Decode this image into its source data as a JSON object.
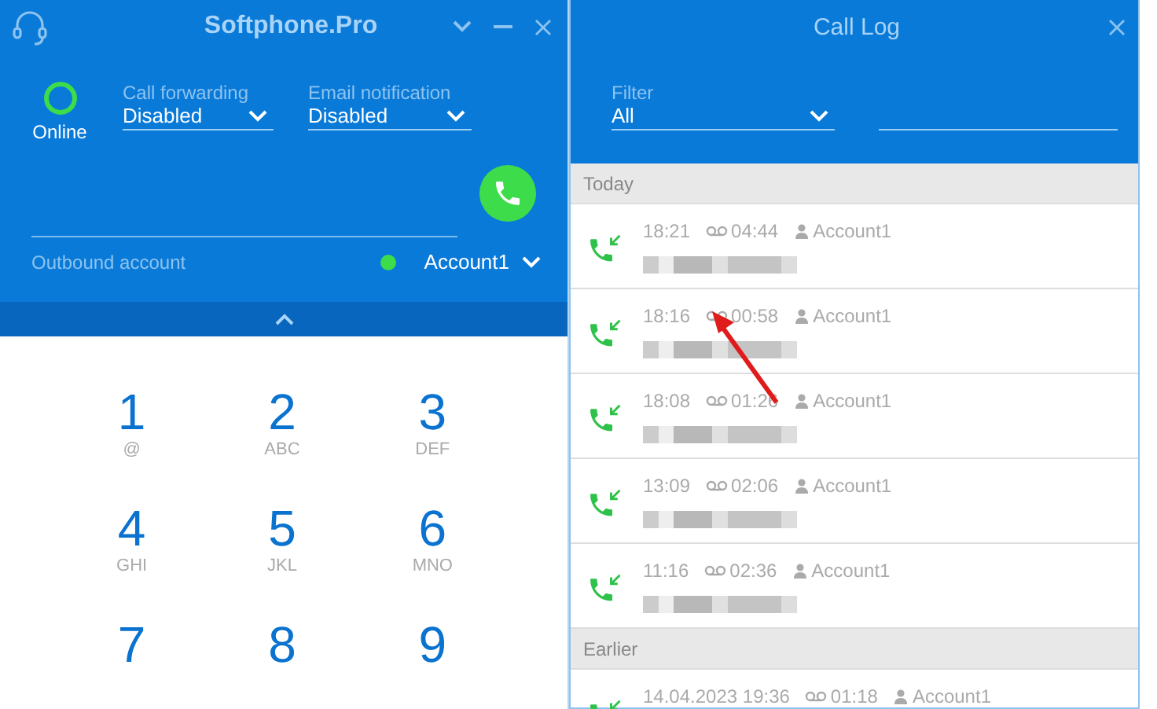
{
  "softphone": {
    "title": "Softphone.Pro",
    "presence": {
      "label": "Online",
      "online": true
    },
    "call_forwarding": {
      "label": "Call forwarding",
      "value": "Disabled"
    },
    "email_notification": {
      "label": "Email notification",
      "value": "Disabled"
    },
    "outbound_account": {
      "label": "Outbound account",
      "account": "Account1",
      "color": "#3ddc4a"
    },
    "keypad": [
      {
        "digit": "1",
        "letters": "@"
      },
      {
        "digit": "2",
        "letters": "ABC"
      },
      {
        "digit": "3",
        "letters": "DEF"
      },
      {
        "digit": "4",
        "letters": "GHI"
      },
      {
        "digit": "5",
        "letters": "JKL"
      },
      {
        "digit": "6",
        "letters": "MNO"
      },
      {
        "digit": "7"
      },
      {
        "digit": "8"
      },
      {
        "digit": "9"
      }
    ]
  },
  "call_log": {
    "title": "Call Log",
    "filter": {
      "label": "Filter",
      "value": "All"
    },
    "groups": [
      {
        "label": "Today",
        "calls": [
          {
            "kind": "incoming",
            "time": "18:21",
            "duration": "04:44",
            "account": "Account1"
          },
          {
            "kind": "incoming",
            "time": "18:16",
            "duration": "00:58",
            "account": "Account1"
          },
          {
            "kind": "incoming",
            "time": "18:08",
            "duration": "01:26",
            "account": "Account1"
          },
          {
            "kind": "incoming",
            "time": "13:09",
            "duration": "02:06",
            "account": "Account1"
          },
          {
            "kind": "incoming",
            "time": "11:16",
            "duration": "02:36",
            "account": "Account1"
          }
        ]
      },
      {
        "label": "Earlier",
        "calls": [
          {
            "kind": "incoming",
            "time": "14.04.2023 19:36",
            "duration": "01:18",
            "account": "Account1"
          }
        ]
      }
    ]
  }
}
